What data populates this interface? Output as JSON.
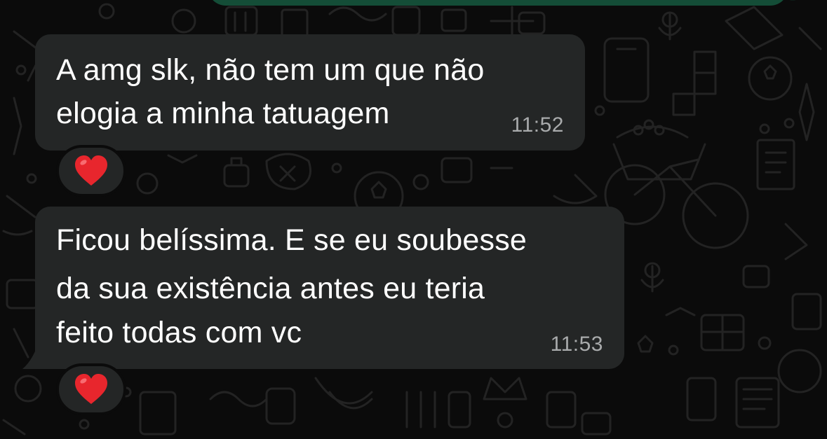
{
  "chat": {
    "messages": [
      {
        "direction": "incoming",
        "lines": [
          "A amg slk, não tem um que não",
          "elogia a minha tatuagem"
        ],
        "time": "11:52",
        "reaction": "heart"
      },
      {
        "direction": "incoming",
        "lines": [
          "Ficou belíssima. E se eu soubesse",
          "da sua existência antes eu teria",
          "feito todas com vc"
        ],
        "time": "11:53",
        "reaction": "heart"
      }
    ]
  },
  "colors": {
    "background": "#0b0b0b",
    "incoming_bubble": "#242626",
    "outgoing_bubble": "#144d37",
    "text": "#ffffff",
    "timestamp": "#a9abac",
    "heart": "#e8262d"
  }
}
